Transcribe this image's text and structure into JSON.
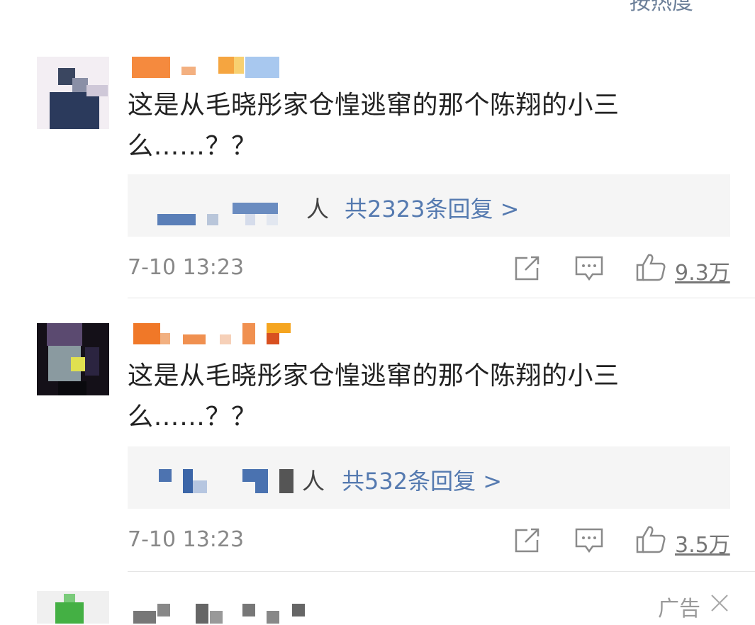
{
  "header": {
    "sort_label": "按热度"
  },
  "comments": [
    {
      "text_line1": "这是从毛晓彤家仓惶逃窜的那个陈翔的小三",
      "text_line2": "么……？？",
      "reply_tail": "人",
      "reply_count": "共2323条回复 >",
      "timestamp": "7-10 13:23",
      "likes": "9.3万"
    },
    {
      "text_line1": "这是从毛晓彤家仓惶逃窜的那个陈翔的小三",
      "text_line2": "么……？？",
      "reply_tail": "人",
      "reply_count": "共532条回复 >",
      "timestamp": "7-10 13:23",
      "likes": "3.5万"
    }
  ],
  "ad": {
    "label": "广告"
  },
  "icons": {
    "share": "share-icon",
    "comment": "comment-icon",
    "like": "thumbs-up-icon",
    "close": "close-icon"
  },
  "colors": {
    "link": "#557ab0",
    "muted": "#888888",
    "reply_bg": "#f5f5f5"
  }
}
